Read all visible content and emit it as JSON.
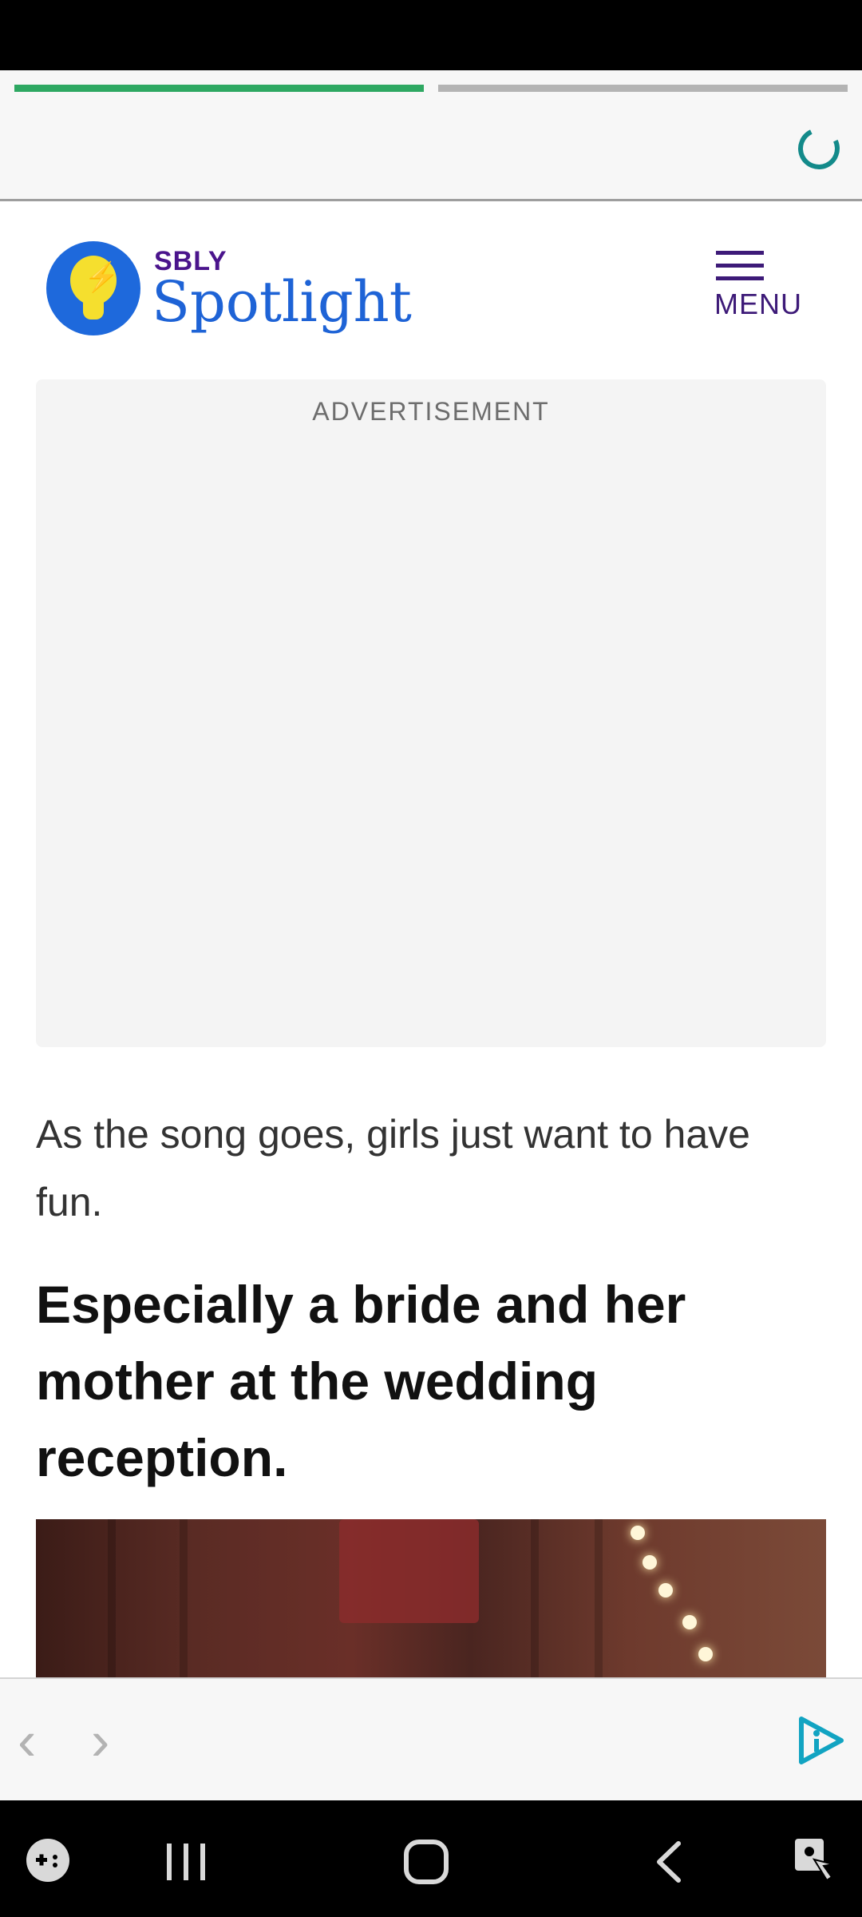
{
  "site": {
    "brand_small": "SBLY",
    "brand_name": "Spotlight",
    "menu_label": "MENU"
  },
  "ad": {
    "label": "ADVERTISEMENT"
  },
  "article": {
    "paragraph": "As the song goes, girls just want to have fun.",
    "heading": "Especially a bride and her mother at the wedding reception."
  },
  "colors": {
    "progress_active": "#2ea862",
    "progress_inactive": "#b4b4b4",
    "brand_blue": "#1e63d6",
    "brand_purple": "#4a148c",
    "spinner": "#138a8a"
  },
  "icons": {
    "back": "chevron-left-icon",
    "forward": "chevron-right-icon",
    "info": "info-play-icon",
    "game": "game-launcher-icon",
    "recents": "recent-apps-icon",
    "home": "home-icon",
    "sys_back": "back-icon",
    "accessibility": "accessibility-icon"
  }
}
